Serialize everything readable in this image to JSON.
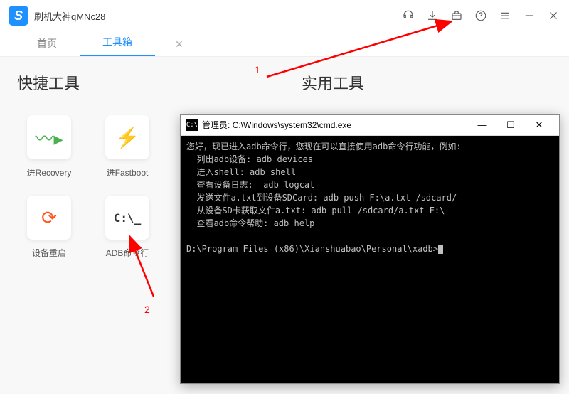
{
  "app": {
    "title": "刷机大神qMNc28"
  },
  "tabs": {
    "home": "首页",
    "toolbox": "工具箱"
  },
  "sections": {
    "quick_tools": "快捷工具",
    "practical_tools": "实用工具"
  },
  "tools": {
    "recovery": "进Recovery",
    "fastboot": "进Fastboot",
    "reboot": "设备重启",
    "adb": "ADB命令行",
    "adb_icon_text": "C:\\_"
  },
  "terminal": {
    "title": "管理员: C:\\Windows\\system32\\cmd.exe",
    "line1": "您好，现已进入adb命令行，您现在可以直接使用adb命令行功能，例如:",
    "line2": "  列出adb设备: adb devices",
    "line3": "  进入shell: adb shell",
    "line4": "  查看设备日志:  adb logcat",
    "line5": "  发送文件a.txt到设备SDCard: adb push F:\\a.txt /sdcard/",
    "line6": "  从设备SD卡获取文件a.txt: adb pull /sdcard/a.txt F:\\",
    "line7": "  查看adb命令帮助: adb help",
    "prompt": "D:\\Program Files (x86)\\Xianshuabao\\Personal\\xadb>"
  },
  "annotations": {
    "one": "1",
    "two": "2"
  }
}
